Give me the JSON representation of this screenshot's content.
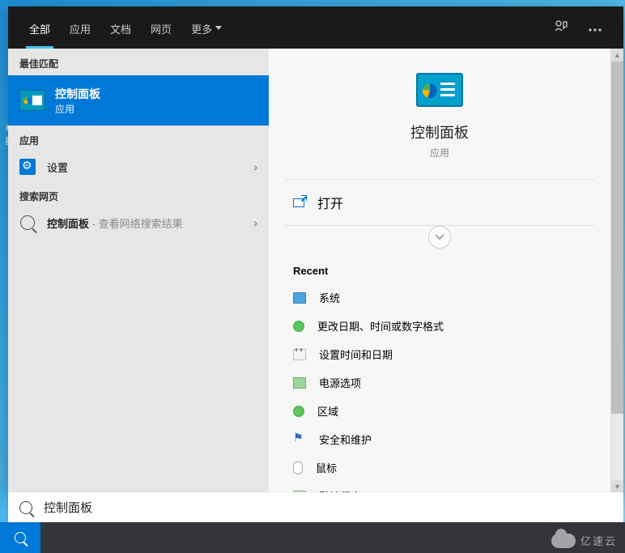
{
  "desktop": {
    "icon_label": "电脑"
  },
  "tabs": {
    "all": "全部",
    "apps": "应用",
    "docs": "文档",
    "web": "网页",
    "more": "更多"
  },
  "left": {
    "best_match_header": "最佳匹配",
    "best_match": {
      "title": "控制面板",
      "subtitle": "应用"
    },
    "apps_header": "应用",
    "settings_label": "设置",
    "web_header": "搜索网页",
    "web_result_bold": "控制面板",
    "web_result_suffix": " - 查看网络搜索结果"
  },
  "right": {
    "title": "控制面板",
    "subtitle": "应用",
    "open_label": "打开",
    "recent_header": "Recent",
    "recent": [
      "系统",
      "更改日期、时间或数字格式",
      "设置时间和日期",
      "电源选项",
      "区域",
      "安全和维护",
      "鼠标",
      "默认程序"
    ]
  },
  "search": {
    "value": "控制面板"
  },
  "watermark": "亿速云"
}
